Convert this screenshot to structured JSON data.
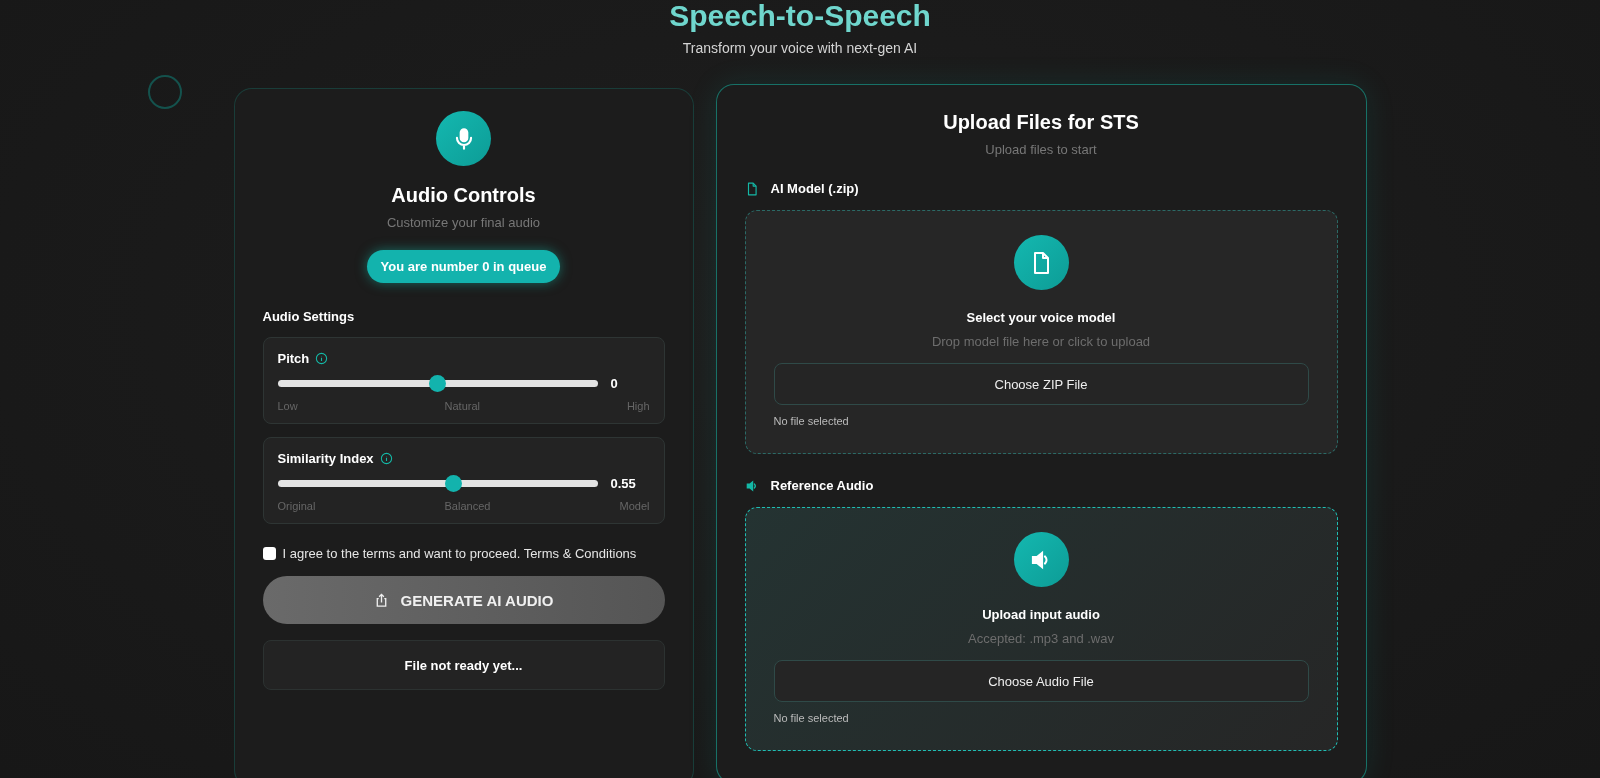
{
  "header": {
    "title": "Speech-to-Speech",
    "subtitle": "Transform your voice with next-gen AI"
  },
  "controls": {
    "title": "Audio Controls",
    "subtitle": "Customize your final audio",
    "queue_badge": "You are number 0 in queue",
    "section_title": "Audio Settings",
    "sliders": [
      {
        "label": "Pitch",
        "level": 0.5,
        "reading": "0",
        "low_label": "Low",
        "mid_label": "Natural",
        "high_label": "High"
      },
      {
        "label": "Similarity Index",
        "level": 0.55,
        "reading": "0.55",
        "low_label": "Original",
        "mid_label": "Balanced",
        "high_label": "Model"
      }
    ],
    "terms": {
      "checked": false,
      "label": "I agree to the terms and want to proceed. Terms & Conditions"
    },
    "generate_button": {
      "label": "GENERATE AI AUDIO",
      "disabled": true
    },
    "status": "File not ready yet..."
  },
  "uploads": {
    "title": "Upload Files for STS",
    "subtitle": "Upload files to start",
    "sections": [
      {
        "kind": "model",
        "label": "AI Model (.zip)",
        "heading": "Select your voice model",
        "hint": "Drop model file here or click to upload",
        "button": "Choose ZIP File",
        "file_status": "No file selected",
        "active": false
      },
      {
        "kind": "audio",
        "label": "Reference Audio",
        "heading": "Upload input audio",
        "hint": "Accepted: .mp3 and .wav",
        "button": "Choose Audio File",
        "file_status": "No file selected",
        "active": true
      }
    ]
  }
}
